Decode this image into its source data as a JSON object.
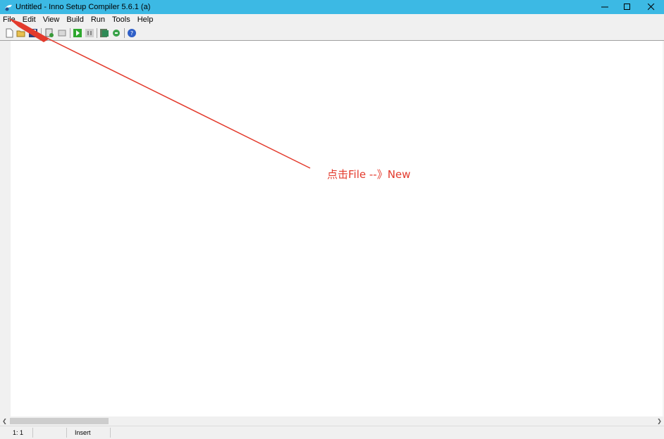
{
  "window": {
    "title": "Untitled - Inno Setup Compiler 5.6.1 (a)",
    "controls": [
      "minimize",
      "maximize",
      "close"
    ]
  },
  "menu": {
    "items": [
      "File",
      "Edit",
      "View",
      "Build",
      "Run",
      "Tools",
      "Help"
    ]
  },
  "toolbar": {
    "buttons": [
      "new-file-icon",
      "open-folder-icon",
      "save-icon",
      "compile-icon",
      "stop-compile-icon",
      "run-icon",
      "pause-icon",
      "target-setup-icon",
      "uninstall-icon",
      "help-icon"
    ]
  },
  "status": {
    "position": "1:   1",
    "mode": "Insert"
  },
  "annotation": {
    "text": "点击File --》New",
    "color": "#e33a2c"
  },
  "colors": {
    "titlebar": "#3cb9e4",
    "annotation": "#e33a2c"
  }
}
